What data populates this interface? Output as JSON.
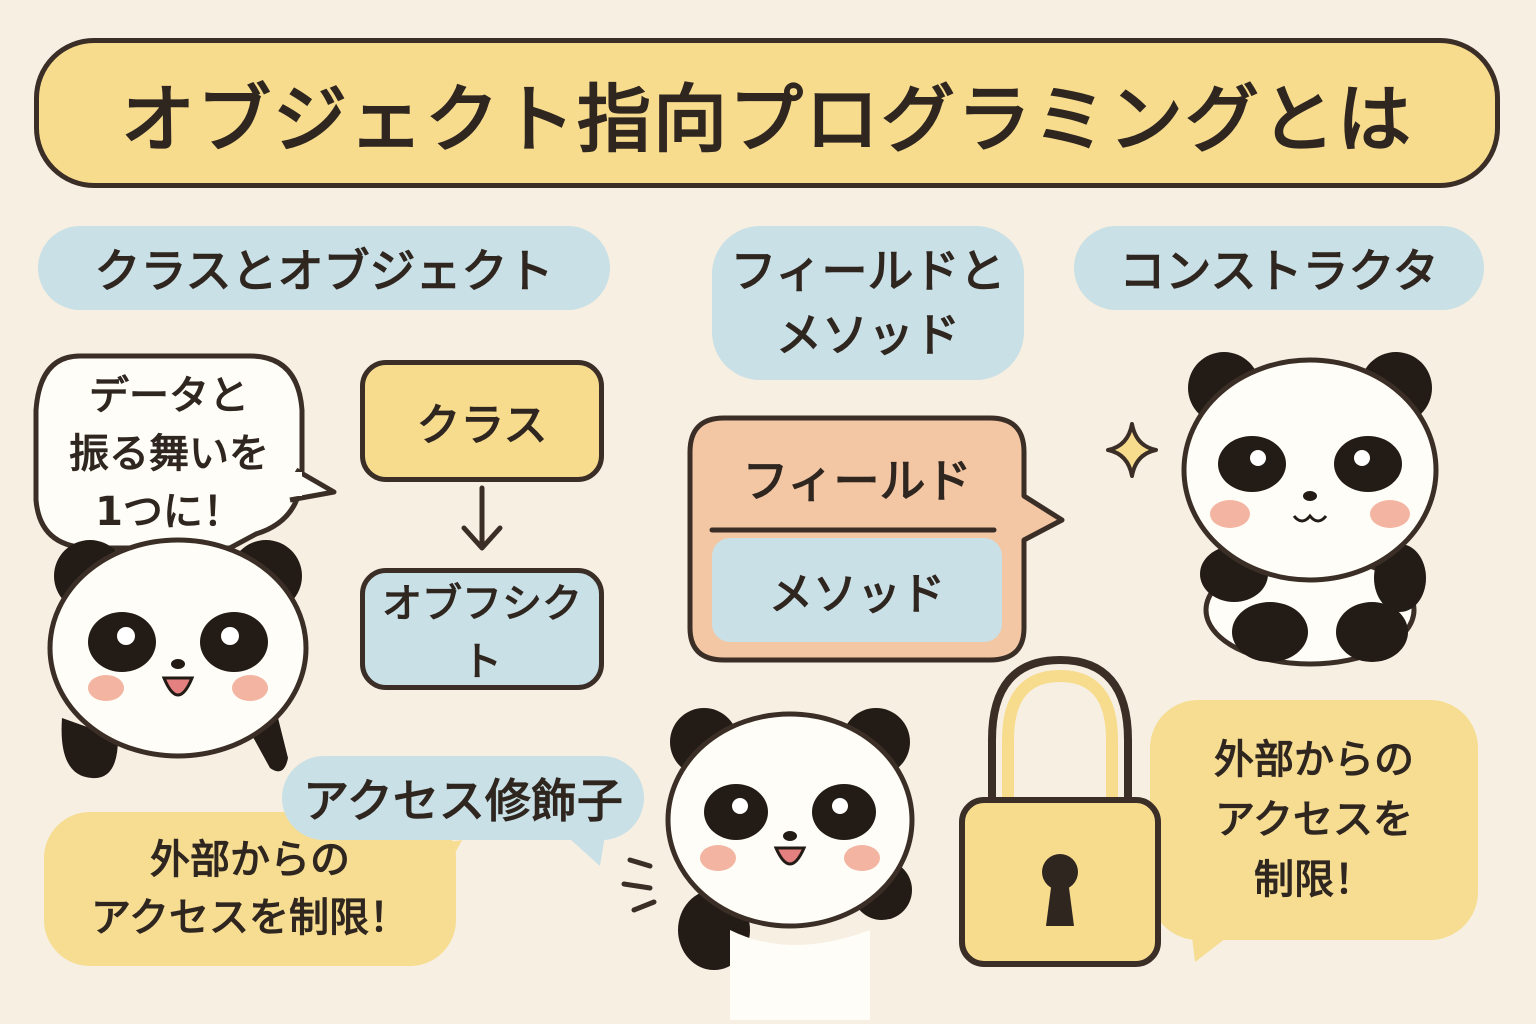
{
  "title": "オブジェクト指向プログラミングとは",
  "sections": {
    "class_object": "クラスとオブジェクト",
    "field_method": "フィールドと\nメソッド",
    "constructor": "コンストラクタ",
    "access_modifier": "アクセス修飾子"
  },
  "speech": {
    "data_behavior": "データと\n振る舞いを\n1つに！",
    "restrict_left": "外部からの\nアクセスを制限！",
    "restrict_right": "外部からの\nアクセスを\n制限！"
  },
  "diagram": {
    "class_label": "クラス",
    "object_label": "オブフシクト"
  },
  "field_method_box": {
    "field": "フィールド",
    "method": "メソッド"
  },
  "colors": {
    "background": "#f7efe2",
    "yellow": "#f7dc8e",
    "blue": "#c9e0e6",
    "peach": "#f3c6a4",
    "outline": "#3a2e26"
  },
  "icons": [
    "panda-icon",
    "arrow-down-icon",
    "sparkle-icon",
    "padlock-icon",
    "motion-lines-icon"
  ]
}
